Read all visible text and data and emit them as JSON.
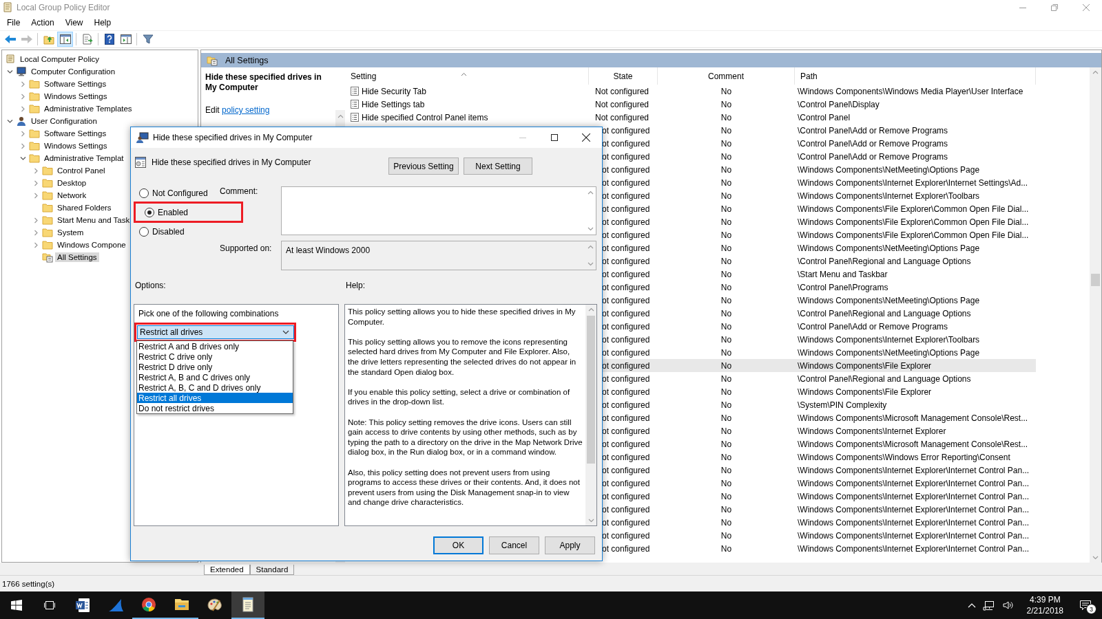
{
  "window": {
    "title": "Local Group Policy Editor"
  },
  "menu": [
    "File",
    "Action",
    "View",
    "Help"
  ],
  "toolbar": [
    {
      "kind": "back",
      "disabled": false,
      "pressed": false
    },
    {
      "kind": "forward",
      "disabled": true,
      "pressed": false
    },
    {
      "kind": "up",
      "disabled": false,
      "pressed": false
    },
    {
      "kind": "tree",
      "disabled": false,
      "pressed": true
    },
    {
      "kind": "export",
      "disabled": false,
      "pressed": false
    },
    {
      "kind": "help",
      "disabled": false,
      "pressed": false
    },
    {
      "kind": "pane",
      "disabled": false,
      "pressed": false
    },
    {
      "kind": "filter",
      "disabled": false,
      "pressed": false
    }
  ],
  "tree": [
    {
      "label": "Local Computer Policy",
      "kind": "policy",
      "selected": false,
      "children": [
        {
          "label": "Computer Configuration",
          "kind": "computer",
          "expanded": true,
          "selected": false,
          "children": [
            {
              "label": "Software Settings",
              "kind": "folder",
              "expanded": false,
              "selected": false
            },
            {
              "label": "Windows Settings",
              "kind": "folder",
              "expanded": false,
              "selected": false
            },
            {
              "label": "Administrative Templates",
              "kind": "folder",
              "expanded": false,
              "selected": false
            }
          ]
        },
        {
          "label": "User Configuration",
          "kind": "user",
          "expanded": true,
          "selected": false,
          "children": [
            {
              "label": "Software Settings",
              "kind": "folder",
              "expanded": false,
              "selected": false
            },
            {
              "label": "Windows Settings",
              "kind": "folder",
              "expanded": false,
              "selected": false
            },
            {
              "label": "Administrative Templat",
              "kind": "folder",
              "expanded": true,
              "selected": false,
              "children": [
                {
                  "label": "Control Panel",
                  "kind": "folder",
                  "expanded": false,
                  "selected": false
                },
                {
                  "label": "Desktop",
                  "kind": "folder",
                  "expanded": false,
                  "selected": false
                },
                {
                  "label": "Network",
                  "kind": "folder",
                  "expanded": false,
                  "selected": false
                },
                {
                  "label": "Shared Folders",
                  "kind": "folder",
                  "selected": false
                },
                {
                  "label": "Start Menu and Task",
                  "kind": "folder",
                  "expanded": false,
                  "selected": false
                },
                {
                  "label": "System",
                  "kind": "folder",
                  "expanded": false,
                  "selected": false
                },
                {
                  "label": "Windows Compone",
                  "kind": "folder",
                  "expanded": false,
                  "selected": false
                },
                {
                  "label": "All Settings",
                  "kind": "settings",
                  "selected": true
                }
              ]
            }
          ]
        }
      ]
    }
  ],
  "pane_title": "All Settings",
  "description": {
    "title": "Hide these specified drives in My Computer",
    "edit": "Edit",
    "link": "policy setting"
  },
  "list": {
    "columns": [
      "Setting",
      "State",
      "Comment",
      "Path"
    ],
    "rows": [
      {
        "setting": "Hide Security Tab",
        "state": "Not configured",
        "comment": "No",
        "path": "\\Windows Components\\Windows Media Player\\User Interface",
        "selected": false
      },
      {
        "setting": "Hide Settings tab",
        "state": "Not configured",
        "comment": "No",
        "path": "\\Control Panel\\Display",
        "selected": false
      },
      {
        "setting": "Hide specified Control Panel items",
        "state": "Not configured",
        "comment": "No",
        "path": "\\Control Panel",
        "selected": false
      },
      {
        "state": "ot configured",
        "comment": "No",
        "path": "\\Control Panel\\Add or Remove Programs",
        "selected": false
      },
      {
        "state": "ot configured",
        "comment": "No",
        "path": "\\Control Panel\\Add or Remove Programs",
        "selected": false
      },
      {
        "state": "ot configured",
        "comment": "No",
        "path": "\\Control Panel\\Add or Remove Programs",
        "selected": false
      },
      {
        "state": "ot configured",
        "comment": "No",
        "path": "\\Windows Components\\NetMeeting\\Options Page",
        "selected": false
      },
      {
        "state": "ot configured",
        "comment": "No",
        "path": "\\Windows Components\\Internet Explorer\\Internet Settings\\Ad...",
        "selected": false
      },
      {
        "state": "ot configured",
        "comment": "No",
        "path": "\\Windows Components\\Internet Explorer\\Toolbars",
        "selected": false
      },
      {
        "state": "ot configured",
        "comment": "No",
        "path": "\\Windows Components\\File Explorer\\Common Open File Dial...",
        "selected": false
      },
      {
        "state": "ot configured",
        "comment": "No",
        "path": "\\Windows Components\\File Explorer\\Common Open File Dial...",
        "selected": false
      },
      {
        "state": "ot configured",
        "comment": "No",
        "path": "\\Windows Components\\File Explorer\\Common Open File Dial...",
        "selected": false
      },
      {
        "state": "ot configured",
        "comment": "No",
        "path": "\\Windows Components\\NetMeeting\\Options Page",
        "selected": false
      },
      {
        "state": "ot configured",
        "comment": "No",
        "path": "\\Control Panel\\Regional and Language Options",
        "selected": false
      },
      {
        "state": "ot configured",
        "comment": "No",
        "path": "\\Start Menu and Taskbar",
        "selected": false
      },
      {
        "state": "ot configured",
        "comment": "No",
        "path": "\\Control Panel\\Programs",
        "selected": false
      },
      {
        "state": "ot configured",
        "comment": "No",
        "path": "\\Windows Components\\NetMeeting\\Options Page",
        "selected": false
      },
      {
        "state": "ot configured",
        "comment": "No",
        "path": "\\Control Panel\\Regional and Language Options",
        "selected": false
      },
      {
        "state": "ot configured",
        "comment": "No",
        "path": "\\Control Panel\\Add or Remove Programs",
        "selected": false
      },
      {
        "state": "ot configured",
        "comment": "No",
        "path": "\\Windows Components\\Internet Explorer\\Toolbars",
        "selected": false
      },
      {
        "state": "ot configured",
        "comment": "No",
        "path": "\\Windows Components\\NetMeeting\\Options Page",
        "selected": false
      },
      {
        "state": "ot configured",
        "comment": "No",
        "path": "\\Windows Components\\File Explorer",
        "selected": true
      },
      {
        "state": "ot configured",
        "comment": "No",
        "path": "\\Control Panel\\Regional and Language Options",
        "selected": false
      },
      {
        "state": "ot configured",
        "comment": "No",
        "path": "\\Windows Components\\File Explorer",
        "selected": false
      },
      {
        "state": "ot configured",
        "comment": "No",
        "path": "\\System\\PIN Complexity",
        "selected": false
      },
      {
        "state": "ot configured",
        "comment": "No",
        "path": "\\Windows Components\\Microsoft Management Console\\Rest...",
        "selected": false
      },
      {
        "state": "ot configured",
        "comment": "No",
        "path": "\\Windows Components\\Internet Explorer",
        "selected": false
      },
      {
        "state": "ot configured",
        "comment": "No",
        "path": "\\Windows Components\\Microsoft Management Console\\Rest...",
        "selected": false
      },
      {
        "state": "ot configured",
        "comment": "No",
        "path": "\\Windows Components\\Windows Error Reporting\\Consent",
        "selected": false
      },
      {
        "state": "ot configured",
        "comment": "No",
        "path": "\\Windows Components\\Internet Explorer\\Internet Control Pan...",
        "selected": false
      },
      {
        "state": "ot configured",
        "comment": "No",
        "path": "\\Windows Components\\Internet Explorer\\Internet Control Pan...",
        "selected": false
      },
      {
        "state": "ot configured",
        "comment": "No",
        "path": "\\Windows Components\\Internet Explorer\\Internet Control Pan...",
        "selected": false
      },
      {
        "state": "ot configured",
        "comment": "No",
        "path": "\\Windows Components\\Internet Explorer\\Internet Control Pan...",
        "selected": false
      },
      {
        "state": "ot configured",
        "comment": "No",
        "path": "\\Windows Components\\Internet Explorer\\Internet Control Pan...",
        "selected": false
      },
      {
        "state": "ot configured",
        "comment": "No",
        "path": "\\Windows Components\\Internet Explorer\\Internet Control Pan...",
        "selected": false
      },
      {
        "state": "ot configured",
        "comment": "No",
        "path": "\\Windows Components\\Internet Explorer\\Internet Control Pan...",
        "selected": false
      }
    ]
  },
  "view_tabs": [
    {
      "label": "Extended",
      "selected": true
    },
    {
      "label": "Standard",
      "selected": false
    }
  ],
  "status": "1766 setting(s)",
  "dialog": {
    "title": "Hide these specified drives in My Computer",
    "minimize_disabled": true,
    "heading": "Hide these specified drives in My Computer",
    "nav_buttons": [
      "Previous Setting",
      "Next Setting"
    ],
    "states": [
      {
        "label": "Not Configured",
        "selected": false,
        "highlighted": false
      },
      {
        "label": "Enabled",
        "selected": true,
        "highlighted": true
      },
      {
        "label": "Disabled",
        "selected": false,
        "highlighted": false
      }
    ],
    "comment_label": "Comment:",
    "supported_label": "Supported on:",
    "supported": "At least Windows 2000",
    "options_label": "Options:",
    "help_label": "Help:",
    "options": {
      "prompt": "Pick one of the following combinations",
      "value": "Restrict all drives",
      "highlighted": true,
      "expanded": true,
      "items": [
        {
          "label": "Restrict A and B drives only",
          "selected": false
        },
        {
          "label": "Restrict C drive only",
          "selected": false
        },
        {
          "label": "Restrict D drive only",
          "selected": false
        },
        {
          "label": "Restrict A, B and C drives only",
          "selected": false
        },
        {
          "label": "Restrict A, B, C and D drives only",
          "selected": false
        },
        {
          "label": "Restrict all drives",
          "selected": true
        },
        {
          "label": "Do not restrict drives",
          "selected": false
        }
      ]
    },
    "help": [
      "This policy setting allows you to hide these specified drives in My Computer.",
      "This policy setting allows you to remove the icons representing selected hard drives from My Computer and File Explorer. Also, the drive letters representing the selected drives do not appear in the standard Open dialog box.",
      "If you enable this policy setting, select a drive or combination of drives in the drop-down list.",
      "Note: This policy setting removes the drive icons. Users can still gain access to drive contents by using other methods, such as by typing the path to a directory on the drive in the Map Network Drive dialog box, in the Run dialog box, or in a command window.",
      "Also, this policy setting does not prevent users from using programs to access these drives or their contents. And, it does not prevent users from using the Disk Management snap-in to view and change drive characteristics."
    ],
    "buttons": [
      {
        "label": "OK",
        "default": true
      },
      {
        "label": "Cancel",
        "default": false
      },
      {
        "label": "Apply",
        "default": false
      }
    ]
  },
  "taskbar": {
    "apps": [
      {
        "kind": "document",
        "running": false,
        "active": false
      },
      {
        "kind": "fin",
        "running": false,
        "active": false
      },
      {
        "kind": "browser",
        "running": true,
        "active": false
      },
      {
        "kind": "folder",
        "running": true,
        "active": false
      },
      {
        "kind": "paint",
        "running": false,
        "active": false
      },
      {
        "kind": "notepad",
        "running": true,
        "active": true
      }
    ],
    "time": "4:39 PM",
    "date": "2/21/2018",
    "notifications": "3"
  }
}
